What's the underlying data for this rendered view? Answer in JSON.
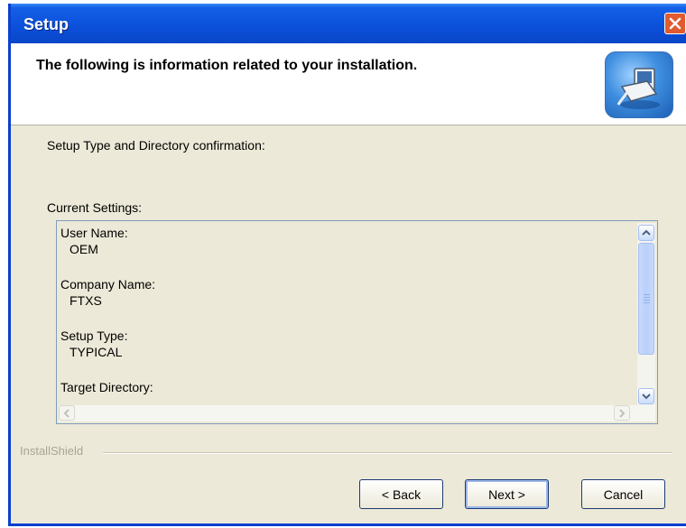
{
  "window": {
    "title": "Setup",
    "close_icon": "close-icon"
  },
  "header": {
    "title": "The following is information related to your installation.",
    "logo_icon": "installer-computer-icon"
  },
  "body": {
    "confirm_label": "Setup Type and Directory confirmation:",
    "current_settings_label": "Current Settings:",
    "settings": [
      {
        "label": "User Name:",
        "value": "OEM"
      },
      {
        "label": "Company Name:",
        "value": "FTXS"
      },
      {
        "label": "Setup Type:",
        "value": "TYPICAL"
      },
      {
        "label": "Target Directory:",
        "value": ""
      }
    ]
  },
  "footer": {
    "brand": "InstallShield",
    "back_label": "< Back",
    "next_label": "Next >",
    "cancel_label": "Cancel"
  },
  "colors": {
    "titlebar": "#0b4fd9",
    "close_button": "#e25a2f",
    "dialog_face": "#ece9d8"
  }
}
